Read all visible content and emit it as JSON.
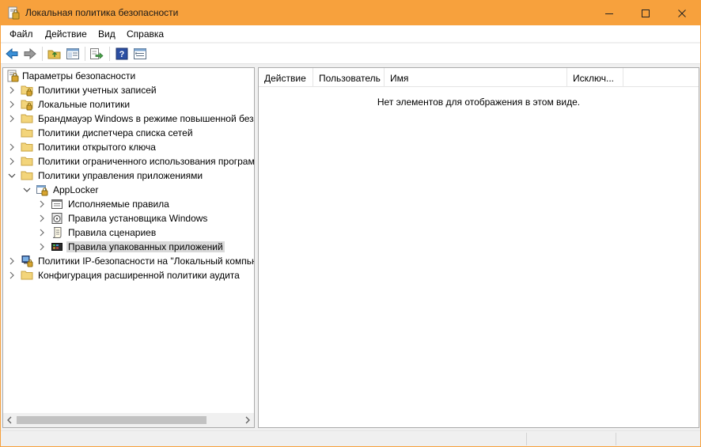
{
  "window": {
    "title": "Локальная политика безопасности",
    "icon": "security-policy-icon",
    "accent_color": "#f7a13d"
  },
  "menu": {
    "items": [
      "Файл",
      "Действие",
      "Вид",
      "Справка"
    ]
  },
  "toolbar": {
    "buttons": [
      "back-icon",
      "forward-icon",
      "up-folder-icon",
      "show-hide-tree-icon",
      "export-list-icon",
      "help-icon",
      "properties-icon"
    ]
  },
  "tree": {
    "root": "Параметры безопасности",
    "items": [
      {
        "label": "Политики учетных записей",
        "icon": "locked-folder-icon",
        "expanded": false
      },
      {
        "label": "Локальные политики",
        "icon": "locked-folder-icon",
        "expanded": false
      },
      {
        "label": "Брандмауэр Windows в режиме повышенной безопасности",
        "icon": "folder-icon",
        "expanded": false
      },
      {
        "label": "Политики диспетчера списка сетей",
        "icon": "folder-icon",
        "expanded": null
      },
      {
        "label": "Политики открытого ключа",
        "icon": "folder-icon",
        "expanded": false
      },
      {
        "label": "Политики ограниченного использования программ",
        "icon": "folder-icon",
        "expanded": false
      },
      {
        "label": "Политики управления приложениями",
        "icon": "folder-icon",
        "expanded": true
      },
      {
        "label": "AppLocker",
        "icon": "applocker-icon",
        "expanded": true
      },
      {
        "label": "Исполняемые правила",
        "icon": "executable-rules-icon",
        "expanded": false
      },
      {
        "label": "Правила установщика Windows",
        "icon": "installer-rules-icon",
        "expanded": false
      },
      {
        "label": "Правила сценариев",
        "icon": "script-rules-icon",
        "expanded": false
      },
      {
        "label": "Правила упакованных приложений",
        "icon": "packaged-app-rules-icon",
        "expanded": false,
        "selected": true
      },
      {
        "label": "Политики IP-безопасности на \"Локальный компьютер\"",
        "icon": "ip-security-icon",
        "expanded": false
      },
      {
        "label": "Конфигурация расширенной политики аудита",
        "icon": "folder-icon",
        "expanded": false
      }
    ]
  },
  "list": {
    "columns": [
      "Действие",
      "Пользователь",
      "Имя",
      "Исключ..."
    ],
    "empty_message": "Нет элементов для отображения в этом виде."
  }
}
